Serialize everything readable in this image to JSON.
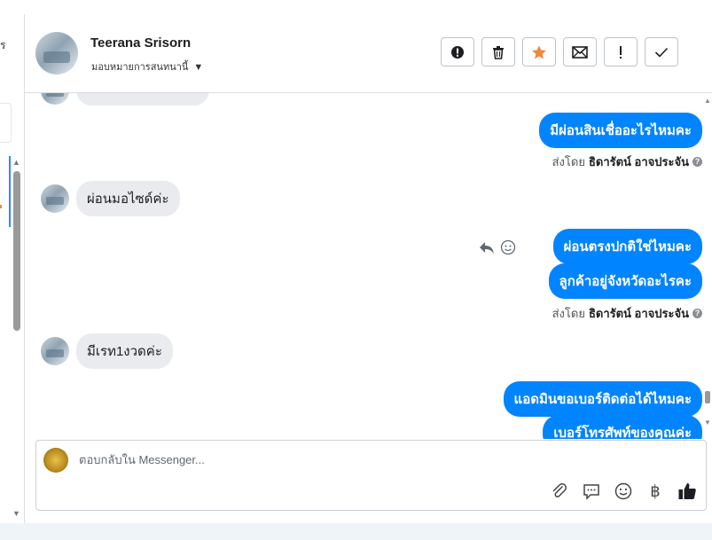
{
  "left_panel": {
    "partial_char": "ร"
  },
  "header": {
    "name": "Teerana Srisorn",
    "assigned": "มอบหมายการสนทนานี้"
  },
  "actions": [
    {
      "name": "spam-button",
      "icon": "alert-circle-icon"
    },
    {
      "name": "delete-button",
      "icon": "trash-icon"
    },
    {
      "name": "star-button",
      "icon": "star-icon",
      "color": "#f0893a"
    },
    {
      "name": "mail-button",
      "icon": "mail-icon"
    },
    {
      "name": "follow-up-button",
      "icon": "exclamation-icon"
    },
    {
      "name": "done-button",
      "icon": "check-icon"
    }
  ],
  "messages": {
    "out1": "มีผ่อนสินเชื่ออะไรไหมคะ",
    "sentby_label": "ส่งโดย",
    "sender": "ธิดารัตน์ อาจประจัน",
    "in1": "ผ่อนมอไซด์ค่ะ",
    "out2": "ผ่อนตรงปกติใช่ไหมคะ",
    "out3": "ลูกค้าอยู่จังหวัดอะไรคะ",
    "in2": "มีเรท1งวดค่ะ",
    "out4": "แอดมินขอเบอร์ติดต่อได้ไหมคะ",
    "out5": "เบอร์โทรศัพท์ของคุณค่ะ"
  },
  "composer": {
    "placeholder": "ตอบกลับใน Messenger..."
  },
  "colors": {
    "accent": "#0084ff",
    "star": "#f0893a"
  }
}
